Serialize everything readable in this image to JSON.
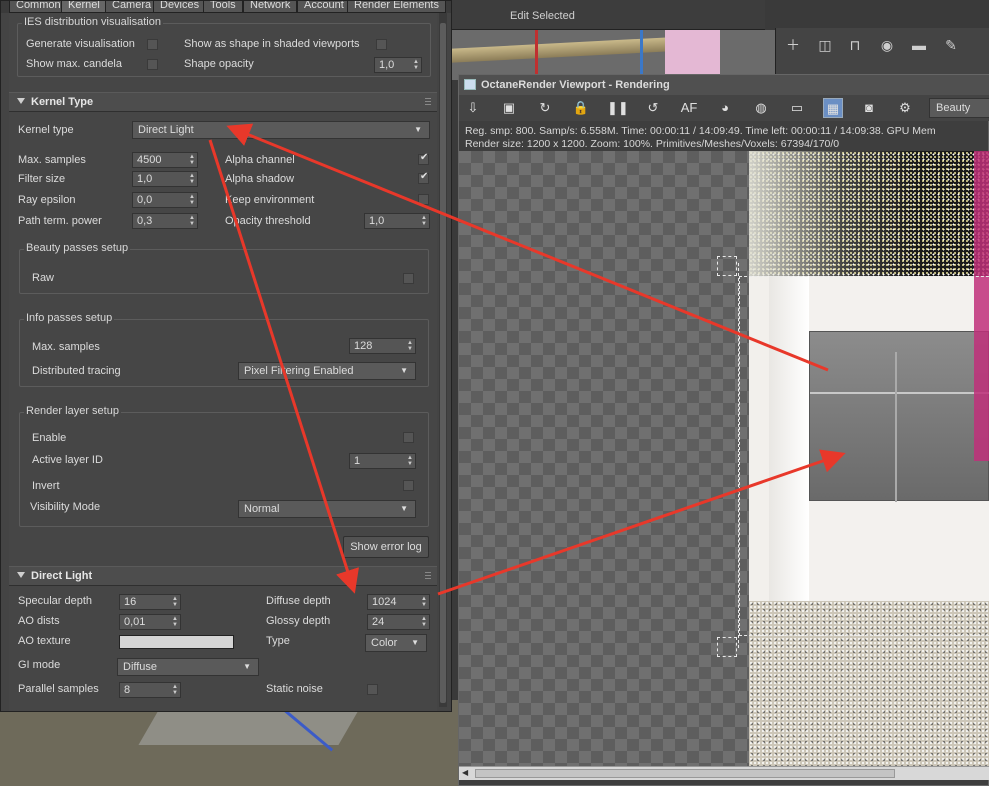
{
  "tabs": [
    "Common",
    "Kernel",
    "Camera",
    "Devices",
    "Tools",
    "Network",
    "Account",
    "Render Elements"
  ],
  "edit_selected": "Edit Selected",
  "ies": {
    "group_title": "IES distribution visualisation",
    "generate_label": "Generate visualisation",
    "show_shape_label": "Show as shape in shaded viewports",
    "show_max_label": "Show max. candela",
    "shape_opacity_label": "Shape opacity",
    "shape_opacity_value": "1,0"
  },
  "kernel": {
    "rollout_title": "Kernel Type",
    "kernel_type_label": "Kernel type",
    "kernel_type_value": "Direct Light",
    "max_samples_label": "Max. samples",
    "max_samples_value": "4500",
    "filter_size_label": "Filter size",
    "filter_size_value": "1,0",
    "ray_epsilon_label": "Ray epsilon",
    "ray_epsilon_value": "0,0",
    "path_term_label": "Path term. power",
    "path_term_value": "0,3",
    "alpha_channel_label": "Alpha channel",
    "alpha_shadow_label": "Alpha shadow",
    "keep_env_label": "Keep environment",
    "opacity_threshold_label": "Opacity threshold",
    "opacity_threshold_value": "1,0"
  },
  "beauty": {
    "title": "Beauty passes setup",
    "raw_label": "Raw"
  },
  "info": {
    "title": "Info passes setup",
    "max_samples_label": "Max. samples",
    "max_samples_value": "128",
    "dist_tracing_label": "Distributed tracing",
    "dist_tracing_value": "Pixel Filtering Enabled"
  },
  "render_layer": {
    "title": "Render layer setup",
    "enable_label": "Enable",
    "active_layer_label": "Active layer ID",
    "active_layer_value": "1",
    "invert_label": "Invert",
    "visibility_label": "Visibility Mode",
    "visibility_value": "Normal"
  },
  "show_error_log": "Show error log",
  "direct_light": {
    "rollout_title": "Direct Light",
    "specular_label": "Specular depth",
    "specular_value": "16",
    "ao_dist_label": "AO dists",
    "ao_dist_value": "0,01",
    "ao_texture_label": "AO texture",
    "gi_mode_label": "GI mode",
    "gi_mode_value": "Diffuse",
    "parallel_label": "Parallel samples",
    "parallel_value": "8",
    "diffuse_label": "Diffuse depth",
    "diffuse_value": "1024",
    "glossy_label": "Glossy depth",
    "glossy_value": "24",
    "type_label": "Type",
    "type_value": "Color",
    "static_noise_label": "Static noise"
  },
  "octane": {
    "title": "OctaneRender Viewport - Rendering",
    "pass_value": "Beauty",
    "status_line1": "Reg. smp: 800.   Samp/s: 6.558M.   Time: 00:00:11 / 14:09:49.   Time left: 00:00:11 / 14:09:38.   GPU Mem",
    "status_line2": "Render size: 1200 x 1200.   Zoom: 100%.   Primitives/Meshes/Voxels: 67394/170/0"
  },
  "colors": {
    "arrow": "#e8382a",
    "accent_active": "#6b8fc4"
  }
}
